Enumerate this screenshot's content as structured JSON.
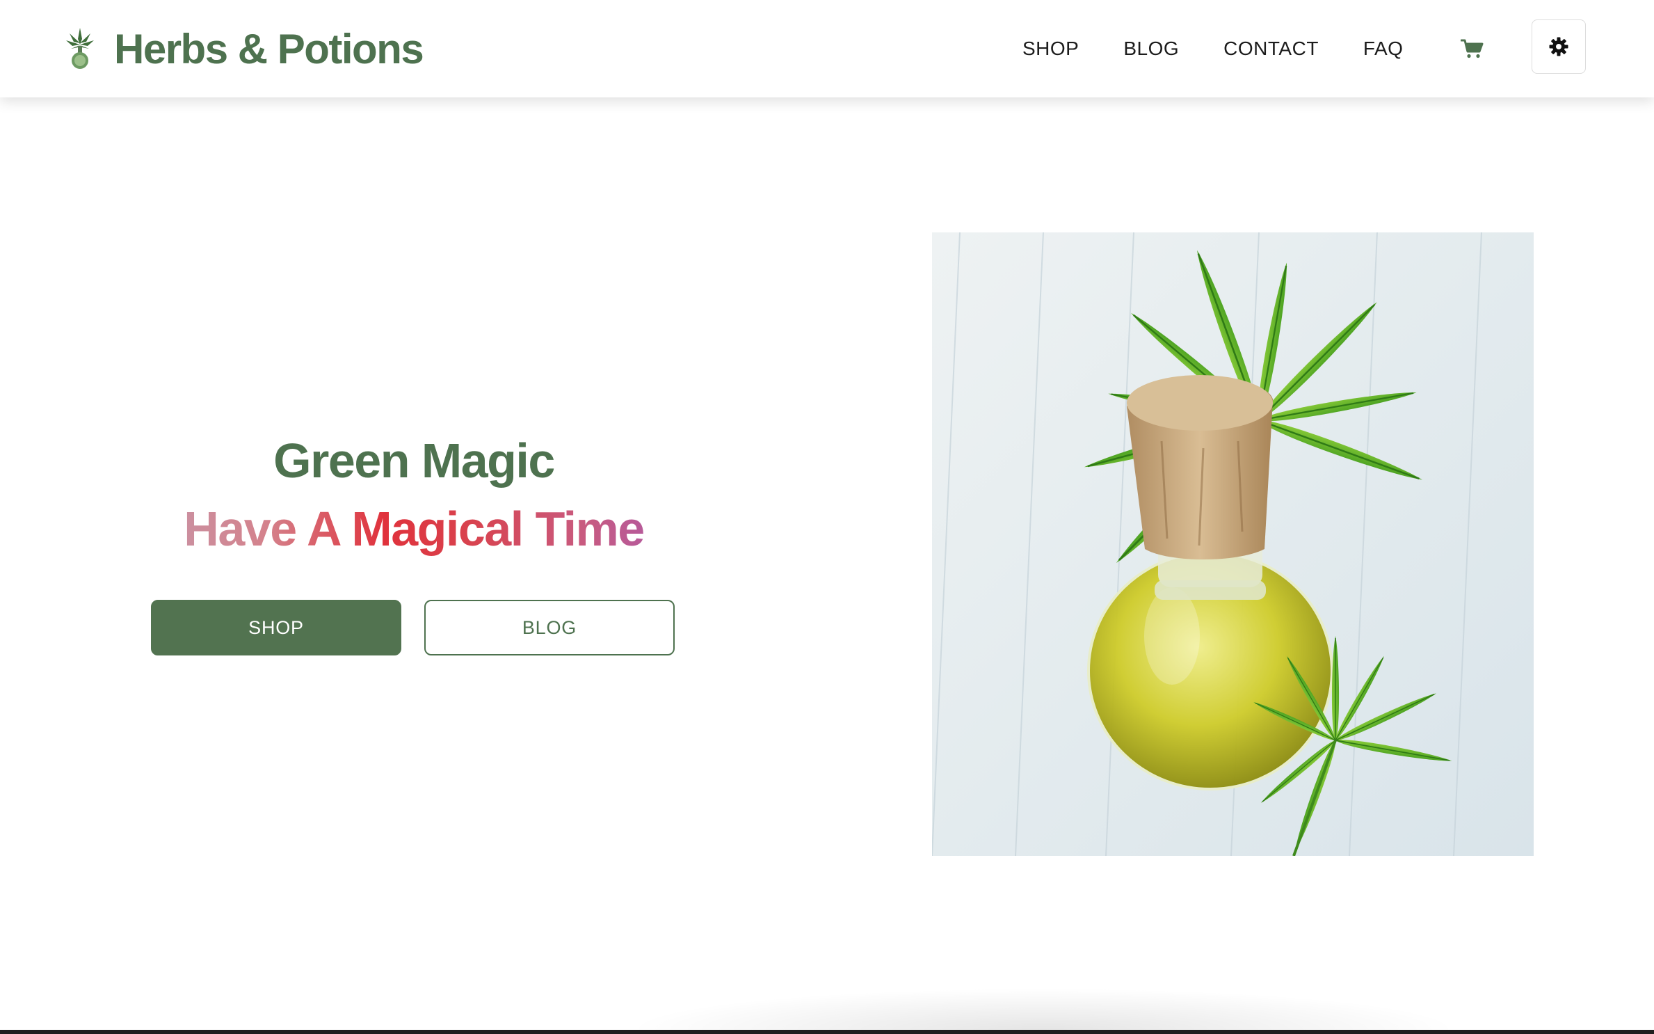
{
  "header": {
    "brand_name": "Herbs & Potions",
    "logo_icon": "cannabis-potion-logo",
    "nav": [
      {
        "label": "SHOP"
      },
      {
        "label": "BLOG"
      },
      {
        "label": "CONTACT"
      },
      {
        "label": "FAQ"
      }
    ],
    "cart_icon": "cart-icon",
    "theme_toggle_icon": "gear-icon"
  },
  "hero": {
    "title": "Green Magic",
    "subtitle": "Have A Magical Time",
    "primary_button": "SHOP",
    "secondary_button": "BLOG",
    "image_subject": "cannabis-oil-bottle-with-leaves"
  },
  "colors": {
    "brand_green": "#4e724f",
    "button_green": "#527350",
    "subtitle_gradient": [
      "#c49aae",
      "#e0323c",
      "#a55ab4"
    ]
  }
}
